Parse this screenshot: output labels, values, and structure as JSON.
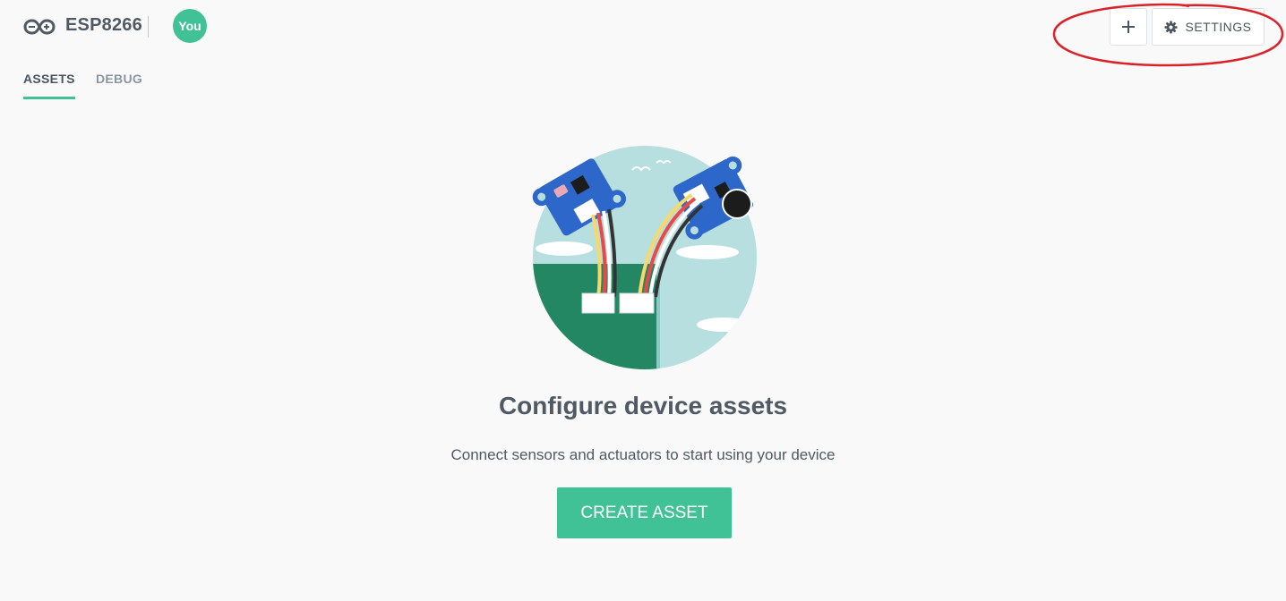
{
  "header": {
    "device_icon": "infinity-icon",
    "device_name": "ESP8266",
    "avatar_label": "You",
    "add_icon": "plus-icon",
    "settings_icon": "gear-icon",
    "settings_label": "SETTINGS"
  },
  "tabs": [
    {
      "label": "ASSETS",
      "active": true
    },
    {
      "label": "DEBUG",
      "active": false
    }
  ],
  "main": {
    "title": "Configure device assets",
    "subtitle": "Connect sensors and actuators to start using your device",
    "create_button": "CREATE ASSET"
  },
  "colors": {
    "accent": "#41c196",
    "background": "#f9f9f9",
    "text": "#4f5a64",
    "annotation": "#d8232a"
  }
}
